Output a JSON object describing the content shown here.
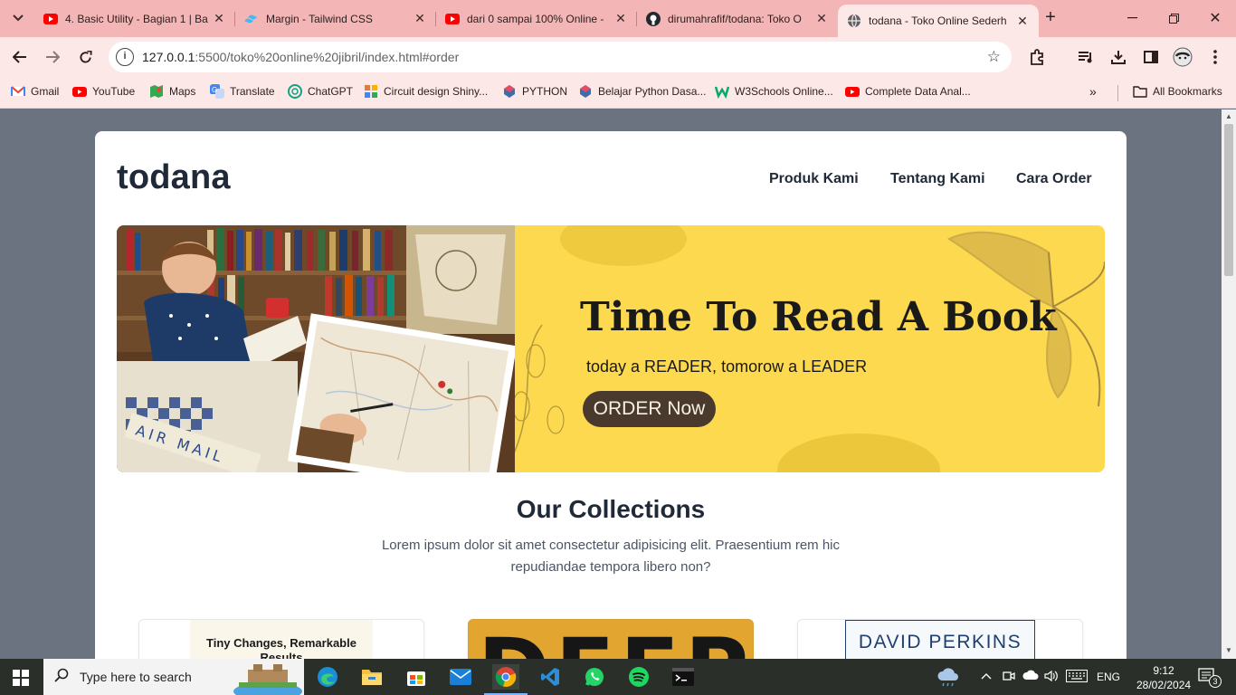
{
  "browser": {
    "tabs": [
      {
        "title": "4. Basic Utility - Bagian 1 | Ba",
        "favicon": "youtube-icon",
        "active": false
      },
      {
        "title": "Margin - Tailwind CSS",
        "favicon": "tailwind-icon",
        "active": false
      },
      {
        "title": "dari 0 sampai 100% Online -",
        "favicon": "youtube-icon",
        "active": false
      },
      {
        "title": "dirumahrafif/todana: Toko O",
        "favicon": "github-icon",
        "active": false
      },
      {
        "title": "todana - Toko Online Sederh",
        "favicon": "globe-icon",
        "active": true
      }
    ],
    "url_host": "127.0.0.1",
    "url_path": ":5500/toko%20online%20jibril/index.html#order",
    "bookmarks": [
      {
        "label": "Gmail",
        "icon": "gmail-icon",
        "color": "#ea4335"
      },
      {
        "label": "YouTube",
        "icon": "youtube-icon",
        "color": "#ff0000"
      },
      {
        "label": "Maps",
        "icon": "maps-icon",
        "color": "#34a853"
      },
      {
        "label": "Translate",
        "icon": "translate-icon",
        "color": "#4285f4"
      },
      {
        "label": "ChatGPT",
        "icon": "chatgpt-icon",
        "color": "#10a37f"
      },
      {
        "label": "Circuit design Shiny...",
        "icon": "circuit-icon",
        "color": "#e07b39"
      },
      {
        "label": "PYTHON",
        "icon": "python-icon",
        "color": "#3f6da8"
      },
      {
        "label": "Belajar Python Dasa...",
        "icon": "python-icon",
        "color": "#3f6da8"
      },
      {
        "label": "W3Schools Online...",
        "icon": "w3schools-icon",
        "color": "#04aa6d"
      },
      {
        "label": "Complete Data Anal...",
        "icon": "youtube-icon",
        "color": "#ff0000"
      }
    ],
    "all_bookmarks": "All Bookmarks"
  },
  "site": {
    "brand": "todana",
    "nav": [
      "Produk Kami",
      "Tentang Kami",
      "Cara Order"
    ],
    "hero": {
      "title": "Time To Read A Book",
      "subtitle": "today a READER, tomorow a LEADER",
      "cta": "ORDER Now",
      "bg_color": "#fcd94e"
    },
    "collections": {
      "title": "Our Collections",
      "description": "Lorem ipsum dolor sit amet consectetur adipisicing elit. Praesentium rem hic repudiandae tempora libero non?"
    },
    "products": [
      {
        "cover_text": "Tiny Changes, Remarkable Results"
      },
      {
        "cover_text": "DEEP"
      },
      {
        "cover_text": "DAVID PERKINS"
      }
    ]
  },
  "taskbar": {
    "search_placeholder": "Type here to search",
    "apps": [
      "edge-icon",
      "file-explorer-icon",
      "store-icon",
      "mail-icon",
      "chrome-icon",
      "vscode-icon",
      "whatsapp-icon",
      "spotify-icon",
      "terminal-icon"
    ],
    "language": "ENG",
    "time": "9:12",
    "date": "28/02/2024",
    "notifications": "3"
  }
}
